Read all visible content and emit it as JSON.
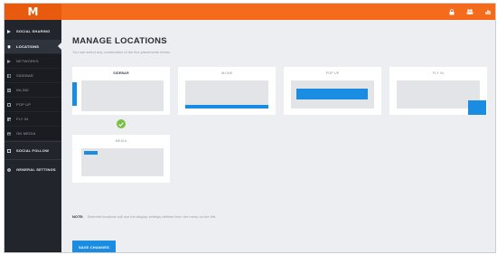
{
  "app": {
    "logo_letter": "M"
  },
  "topbar": {
    "icons": [
      "lock-icon",
      "users-icon",
      "bar-chart-icon"
    ]
  },
  "sidebar": {
    "items": [
      {
        "label": "SOCIAL SHARING",
        "icon": "share-icon",
        "kind": "main"
      },
      {
        "label": "LOCATIONS",
        "icon": "location-pin-icon",
        "kind": "active"
      },
      {
        "label": "NETWORKS",
        "icon": "share-icon",
        "kind": "sub"
      },
      {
        "label": "SIDEBAR",
        "icon": "layout-icon",
        "kind": "sub"
      },
      {
        "label": "INLINE",
        "icon": "inline-icon",
        "kind": "sub"
      },
      {
        "label": "POP UP",
        "icon": "popup-icon",
        "kind": "sub"
      },
      {
        "label": "FLY IN",
        "icon": "flyin-icon",
        "kind": "sub"
      },
      {
        "label": "ON MEDIA",
        "icon": "media-icon",
        "kind": "sub"
      },
      {
        "label": "SOCIAL FOLLOW",
        "icon": "follow-icon",
        "kind": "main"
      },
      {
        "label": "GENERAL SETTINGS",
        "icon": "gear-icon",
        "kind": "main"
      }
    ]
  },
  "main": {
    "title": "MANAGE LOCATIONS",
    "subtitle": "You can select any combination of the five placements below.",
    "locations": [
      {
        "label": "SIDEBAR",
        "selected": true
      },
      {
        "label": "INLINE",
        "selected": false
      },
      {
        "label": "POP UP",
        "selected": false
      },
      {
        "label": "FLY IN",
        "selected": false
      },
      {
        "label": "MEDIA",
        "selected": false
      }
    ],
    "note_label": "NOTE:",
    "note_text": "Selected locations will use the display settings defined from the menu on the left.",
    "save_label": "SAVE CHANGES"
  },
  "colors": {
    "accent": "#f56b1c",
    "primary_blue": "#1a8de3",
    "sidebar_bg": "#22252c",
    "check_green": "#7ac143"
  }
}
